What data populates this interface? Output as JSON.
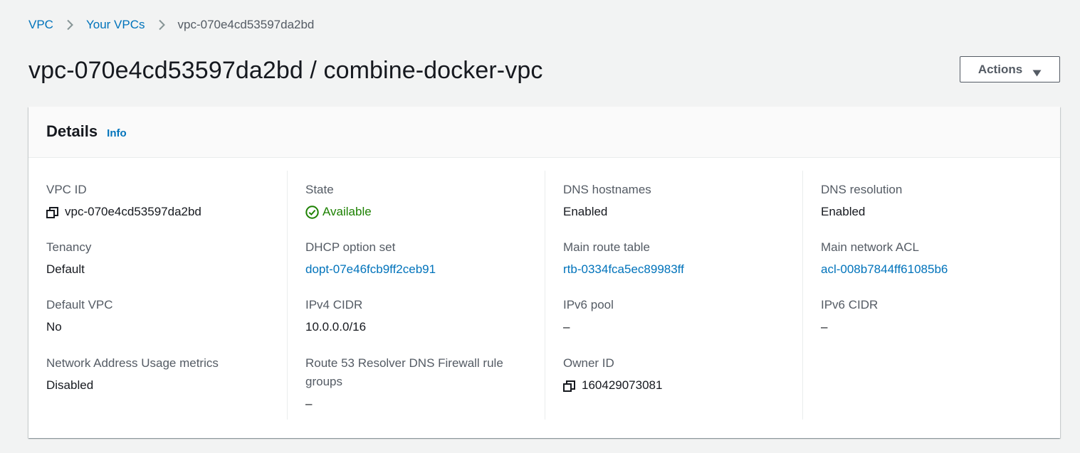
{
  "breadcrumb": {
    "items": [
      "VPC",
      "Your VPCs"
    ],
    "current": "vpc-070e4cd53597da2bd"
  },
  "header": {
    "title": "vpc-070e4cd53597da2bd / combine-docker-vpc",
    "actions_label": "Actions"
  },
  "details": {
    "title": "Details",
    "info_label": "Info",
    "columns": [
      [
        {
          "label": "VPC ID",
          "value": "vpc-070e4cd53597da2bd"
        },
        {
          "label": "Tenancy",
          "value": "Default"
        },
        {
          "label": "Default VPC",
          "value": "No"
        },
        {
          "label": "Network Address Usage metrics",
          "value": "Disabled"
        }
      ],
      [
        {
          "label": "State",
          "value": "Available"
        },
        {
          "label": "DHCP option set",
          "value": "dopt-07e46fcb9ff2ceb91"
        },
        {
          "label": "IPv4 CIDR",
          "value": "10.0.0.0/16"
        },
        {
          "label": "Route 53 Resolver DNS Firewall rule groups",
          "value": "–"
        }
      ],
      [
        {
          "label": "DNS hostnames",
          "value": "Enabled"
        },
        {
          "label": "Main route table",
          "value": "rtb-0334fca5ec89983ff"
        },
        {
          "label": "IPv6 pool",
          "value": "–"
        },
        {
          "label": "Owner ID",
          "value": "160429073081"
        }
      ],
      [
        {
          "label": "DNS resolution",
          "value": "Enabled"
        },
        {
          "label": "Main network ACL",
          "value": "acl-008b7844ff61085b6"
        },
        {
          "label": "IPv6 CIDR",
          "value": "–"
        }
      ]
    ]
  },
  "colors": {
    "link": "#0073bb",
    "success": "#1d8102",
    "text": "#16191f",
    "muted": "#545b64"
  }
}
